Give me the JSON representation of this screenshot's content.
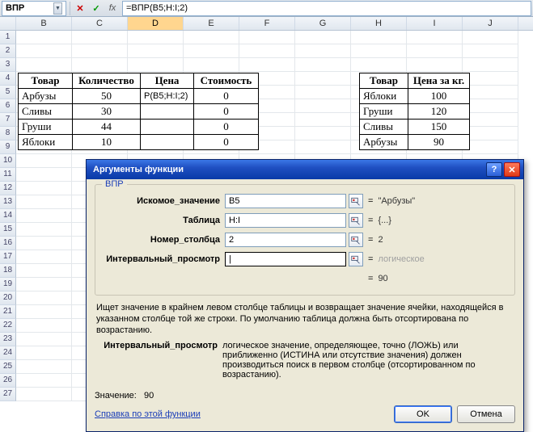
{
  "formula_bar": {
    "name_box": "ВПР",
    "cancel_glyph": "✕",
    "accept_glyph": "✓",
    "fx_label": "fx",
    "formula": "=ВПР(B5;H:I;2)"
  },
  "columns": [
    "B",
    "C",
    "D",
    "E",
    "F",
    "G",
    "H",
    "I",
    "J"
  ],
  "active_column": "D",
  "main_table": {
    "headers": [
      "Товар",
      "Количество",
      "Цена",
      "Стоимость"
    ],
    "rows": [
      {
        "product": "Арбузы",
        "qty": "50",
        "price": "Р(B5;H:I;2)",
        "cost": "0"
      },
      {
        "product": "Сливы",
        "qty": "30",
        "price": "",
        "cost": "0"
      },
      {
        "product": "Груши",
        "qty": "44",
        "price": "",
        "cost": "0"
      },
      {
        "product": "Яблоки",
        "qty": "10",
        "price": "",
        "cost": "0"
      }
    ]
  },
  "lookup_table": {
    "headers": [
      "Товар",
      "Цена за кг."
    ],
    "rows": [
      {
        "product": "Яблоки",
        "price": "100"
      },
      {
        "product": "Груши",
        "price": "120"
      },
      {
        "product": "Сливы",
        "price": "150"
      },
      {
        "product": "Арбузы",
        "price": "90"
      }
    ]
  },
  "dialog": {
    "title": "Аргументы функции",
    "help_glyph": "?",
    "close_glyph": "✕",
    "func_name": "ВПР",
    "args": [
      {
        "label": "Искомое_значение",
        "value": "B5",
        "result": "\"Арбузы\""
      },
      {
        "label": "Таблица",
        "value": "H:I",
        "result": "{...}"
      },
      {
        "label": "Номер_столбца",
        "value": "2",
        "result": "2"
      },
      {
        "label": "Интервальный_просмотр",
        "value": "",
        "result": "логическое",
        "gray": true,
        "focused": true
      }
    ],
    "overall_result_label": "=  ",
    "overall_result": "90",
    "description": "Ищет значение в крайнем левом столбце таблицы и возвращает значение ячейки, находящейся в указанном столбце той же строки. По умолчанию таблица должна быть отсортирована по возрастанию.",
    "arg_desc_label": "Интервальный_просмотр",
    "arg_desc": "логическое значение, определяющее, точно (ЛОЖЬ) или приближенно (ИСТИНА или отсутствие значения) должен производиться поиск в первом столбце (отсортированном по возрастанию).",
    "value_label": "Значение:",
    "value_result": "90",
    "help_link": "Справка по этой функции",
    "ok": "OK",
    "cancel": "Отмена"
  }
}
